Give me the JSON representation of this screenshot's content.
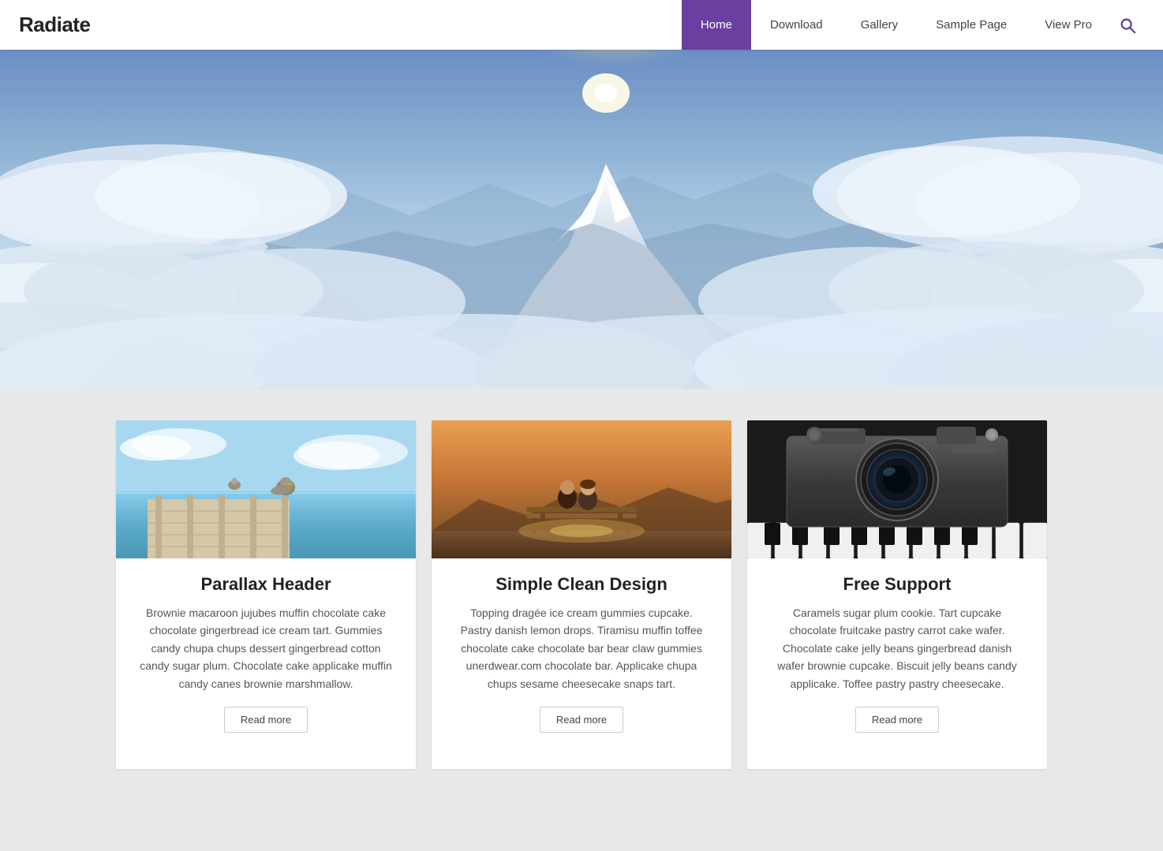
{
  "site": {
    "title": "Radiate"
  },
  "nav": {
    "items": [
      {
        "label": "Home",
        "active": true,
        "id": "home"
      },
      {
        "label": "Download",
        "active": false,
        "id": "download"
      },
      {
        "label": "Gallery",
        "active": false,
        "id": "gallery"
      },
      {
        "label": "Sample Page",
        "active": false,
        "id": "sample-page"
      },
      {
        "label": "View Pro",
        "active": false,
        "id": "view-pro"
      }
    ]
  },
  "hero": {
    "alt": "Mountain landscape above the clouds"
  },
  "cards": [
    {
      "id": "card-parallax",
      "image_alt": "Pelicans on a pier",
      "title": "Parallax Header",
      "text": "Brownie macaroon jujubes muffin chocolate cake chocolate gingerbread ice cream tart. Gummies candy chupa chups dessert gingerbread cotton candy sugar plum. Chocolate cake applicake muffin candy canes brownie marshmallow.",
      "read_more": "Read more"
    },
    {
      "id": "card-clean",
      "image_alt": "Couple sitting on a bench",
      "title": "Simple Clean Design",
      "text": "Topping dragée ice cream gummies cupcake. Pastry danish lemon drops. Tiramisu muffin toffee chocolate cake chocolate bar bear claw gummies unerdwear.com chocolate bar. Applicake chupa chups sesame cheesecake snaps tart.",
      "read_more": "Read more"
    },
    {
      "id": "card-support",
      "image_alt": "Vintage camera on piano keys",
      "title": "Free Support",
      "text": "Caramels sugar plum cookie. Tart cupcake chocolate fruitcake pastry carrot cake wafer. Chocolate cake jelly beans gingerbread danish wafer brownie cupcake. Biscuit jelly beans candy applicake. Toffee pastry pastry cheesecake.",
      "read_more": "Read more"
    }
  ],
  "colors": {
    "nav_active_bg": "#6b3fa0",
    "search_icon": "#6b3fa0"
  }
}
